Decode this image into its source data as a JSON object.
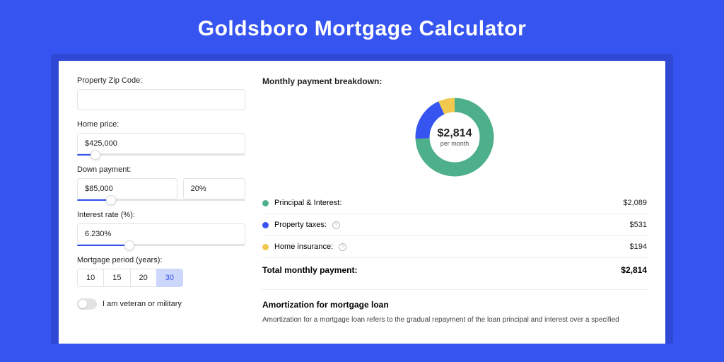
{
  "header": {
    "title": "Goldsboro Mortgage Calculator"
  },
  "form": {
    "zip_label": "Property Zip Code:",
    "zip_value": "",
    "home_price_label": "Home price:",
    "home_price_value": "$425,000",
    "home_price_slider_pct": 11,
    "down_payment_label": "Down payment:",
    "down_payment_value": "$85,000",
    "down_payment_pct_value": "20%",
    "down_payment_slider_pct": 20,
    "interest_label": "Interest rate (%):",
    "interest_value": "6.230%",
    "interest_slider_pct": 31,
    "period_label": "Mortgage period (years):",
    "periods": [
      "10",
      "15",
      "20",
      "30"
    ],
    "period_active_index": 3,
    "veteran_label": "I am veteran or military",
    "veteran_on": false
  },
  "breakdown": {
    "title": "Monthly payment breakdown:",
    "donut_amount": "$2,814",
    "donut_sub": "per month",
    "items": [
      {
        "label": "Principal & Interest:",
        "value": "$2,089",
        "color": "#4eb08a",
        "info": false
      },
      {
        "label": "Property taxes:",
        "value": "$531",
        "color": "#3654f0",
        "info": true
      },
      {
        "label": "Home insurance:",
        "value": "$194",
        "color": "#f0c94e",
        "info": true
      }
    ],
    "total_label": "Total monthly payment:",
    "total_value": "$2,814"
  },
  "chart_data": {
    "type": "pie",
    "title": "Monthly payment breakdown",
    "series": [
      {
        "name": "Principal & Interest",
        "value": 2089,
        "color": "#4eb08a"
      },
      {
        "name": "Property taxes",
        "value": 531,
        "color": "#3654f0"
      },
      {
        "name": "Home insurance",
        "value": 194,
        "color": "#f0c94e"
      }
    ],
    "total": 2814,
    "center_label": "$2,814 per month"
  },
  "amortization": {
    "heading": "Amortization for mortgage loan",
    "body": "Amortization for a mortgage loan refers to the gradual repayment of the loan principal and interest over a specified"
  }
}
